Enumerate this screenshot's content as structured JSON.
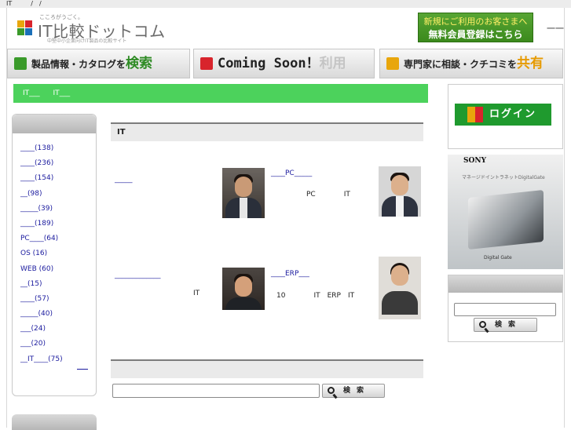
{
  "topbar": {
    "text": "IT　　　/　/"
  },
  "logo": {
    "tagline": "こころがうごく。",
    "name": "IT比較ドットコム",
    "subtitle": "中堅中小企業向けIT製品の比較サイト"
  },
  "register": {
    "line1": "新規にご利用のお客さまへ",
    "line2": "無料会員登録はこちら"
  },
  "category_label": "一一",
  "nav": {
    "btn1_text": "製品情報・カタログを",
    "btn1_highlight": "検索",
    "btn2_text": "Coming Soon！",
    "btn2_grey": "利用",
    "btn3_text": "専門家に相談・クチコミを",
    "btn3_highlight": "共有"
  },
  "breadcrumb": {
    "item1": "IT___",
    "item2": "IT___"
  },
  "sidebar": {
    "items": [
      {
        "label": "____(138)"
      },
      {
        "label": "____(236)"
      },
      {
        "label": "____(154)"
      },
      {
        "label": "__(98)"
      },
      {
        "label": "_____(39)"
      },
      {
        "label": "____(189)"
      },
      {
        "label": "PC____(64)"
      },
      {
        "label": "OS (16)"
      },
      {
        "label": "WEB (60)"
      },
      {
        "label": "__(15)"
      },
      {
        "label": "____(57)"
      },
      {
        "label": "_____(40)"
      },
      {
        "label": "___(24)"
      },
      {
        "label": "___(20)"
      },
      {
        "label": "__IT____(75)"
      }
    ]
  },
  "section1": {
    "title": "IT"
  },
  "entries": {
    "e1": {
      "link": "_____",
      "title": "____PC_____",
      "desc": "PC　　　　IT"
    },
    "e2": {
      "link": "_____________",
      "text": "IT",
      "title": "____ERP___",
      "desc": "10　　　　IT　ERP　IT"
    }
  },
  "section2": {
    "title": ""
  },
  "search": {
    "button_label": "検索",
    "placeholder": ""
  },
  "login": {
    "label": "ログイン"
  },
  "ad": {
    "brand": "SONY",
    "subtitle": "マネージドイントラネットDigitalGate",
    "footer": "Digital Gate"
  },
  "right_search": {
    "button_label": "検索"
  },
  "colors": {
    "accent_green": "#4cd25c",
    "brand_green": "#1f9a2e",
    "orange": "#e69a00"
  }
}
